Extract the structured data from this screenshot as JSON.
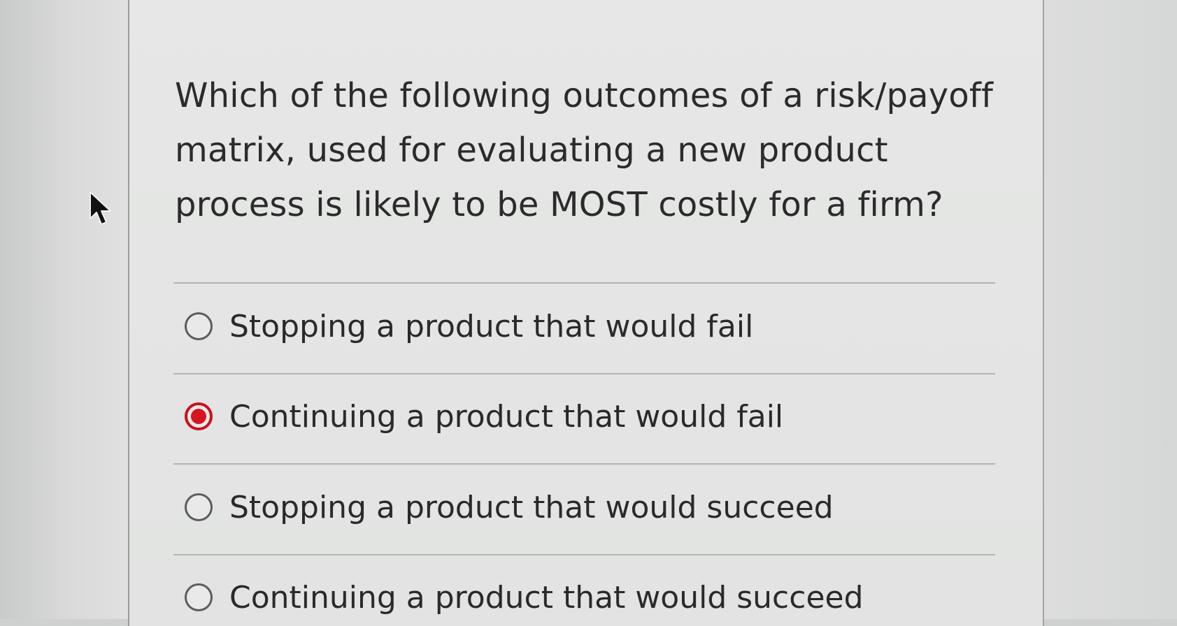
{
  "question": {
    "text": "Which of the following outcomes of a risk/payoff matrix, used for evaluating a new product process is likely to be MOST costly for a firm?"
  },
  "options": [
    {
      "label": "Stopping a product that would fail",
      "selected": false
    },
    {
      "label": "Continuing a product that would fail",
      "selected": true
    },
    {
      "label": "Stopping a product that would succeed",
      "selected": false
    },
    {
      "label": "Continuing a product that would succeed",
      "selected": false
    }
  ],
  "colors": {
    "selected_radio": "#d51620",
    "text": "#2a2a2a",
    "card_background": "#e4e5e4"
  },
  "icons": {
    "cursor": "mouse-pointer-icon"
  }
}
